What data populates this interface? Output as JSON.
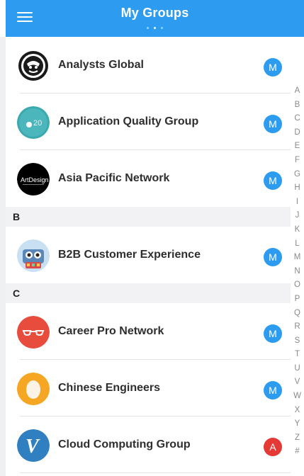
{
  "header": {
    "title": "My Groups",
    "accent_color": "#2d9cf0",
    "page_indicator": {
      "count": 3,
      "active_index": 1
    }
  },
  "groups_a": [
    {
      "name": "Analysts Global",
      "badge": "M",
      "icon": "analysts-global-logo"
    },
    {
      "name": "Application Quality Group",
      "badge": "M",
      "icon": "application-quality-logo"
    },
    {
      "name": "Asia Pacific Network",
      "badge": "M",
      "icon": "asia-pacific-logo"
    }
  ],
  "section_b": "B",
  "groups_b": [
    {
      "name": "B2B Customer Experience",
      "badge": "M",
      "icon": "b2b-robot-logo"
    }
  ],
  "section_c": "C",
  "groups_c": [
    {
      "name": "Career Pro Network",
      "badge": "M",
      "icon": "glasses-logo"
    },
    {
      "name": "Chinese Engineers",
      "badge": "M",
      "icon": "egg-logo"
    },
    {
      "name": "Cloud Computing Group",
      "badge": "A",
      "icon": "v-script-logo"
    }
  ],
  "badge_colors": {
    "M": "#2d9cf0",
    "A": "#e53935"
  },
  "alpha_index": [
    "A",
    "B",
    "C",
    "D",
    "E",
    "F",
    "G",
    "H",
    "I",
    "J",
    "K",
    "L",
    "M",
    "N",
    "O",
    "P",
    "Q",
    "R",
    "S",
    "T",
    "U",
    "V",
    "W",
    "X",
    "Y",
    "Z",
    "#"
  ]
}
